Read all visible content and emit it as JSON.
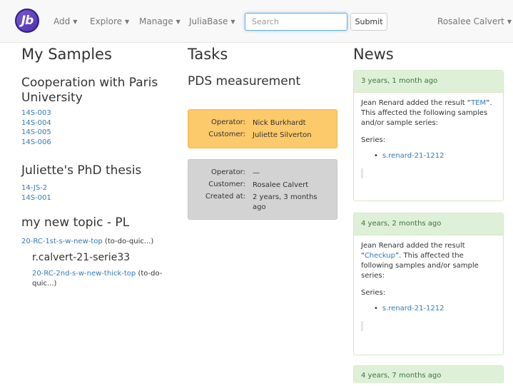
{
  "navbar": {
    "logo_text": "Jb",
    "menus": [
      "Add",
      "Explore",
      "Manage",
      "JuliaBase"
    ],
    "search_placeholder": "Search",
    "submit_label": "Submit",
    "user_name": "Rosalee Calvert"
  },
  "my_samples": {
    "heading": "My Samples",
    "topics": [
      {
        "title_line1": "Cooperation with Paris",
        "title_line2": "University",
        "samples": [
          "14S-003",
          "14S-004",
          "14S-005",
          "14S-006"
        ]
      },
      {
        "title": "Juliette's PhD thesis",
        "samples": [
          "14-JS-2",
          "14S-001"
        ]
      },
      {
        "title": "my new topic - PL",
        "sample_link": "20-RC-1st-s-w-new-top",
        "sample_suffix": " (to-do-quic...)",
        "series_title": "r.calvert-21-serie33",
        "series_link": "20-RC-2nd-s-w-new-thick-top",
        "series_suffix_1": " (to-do-",
        "series_suffix_2": "quic...)"
      }
    ]
  },
  "tasks": {
    "heading": "Tasks",
    "process": "PDS measurement",
    "items": [
      {
        "operator_label": "Operator:",
        "operator": "Nick Burkhardt",
        "customer_label": "Customer:",
        "customer": "Juliette Silverton"
      },
      {
        "operator_label": "Operator:",
        "operator": "—",
        "customer_label": "Customer:",
        "customer": "Rosalee Calvert",
        "created_label": "Created at:",
        "created_1": "2 years, 3 months",
        "created_2": "ago"
      }
    ],
    "colors": {
      "task_1_bg": "#fcc96b",
      "task_2_bg": "#d3d3d3"
    }
  },
  "news": {
    "heading": "News",
    "items": [
      {
        "time": "3 years, 1 month ago",
        "text_pre": "Jean Renard added the result “",
        "link": "TEM",
        "text_post": "”. This affected the following samples and/or sample series:",
        "series_label": "Series:",
        "series_link": "s.renard-21-1212"
      },
      {
        "time": "4 years, 2 months ago",
        "text_pre": "Jean Renard added the result “",
        "link": "Checkup",
        "text_post": "”. This affected the following samples and/or sample series:",
        "series_label": "Series:",
        "series_link": "s.renard-21-1212"
      },
      {
        "time": "4 years, 7 months ago"
      }
    ]
  }
}
